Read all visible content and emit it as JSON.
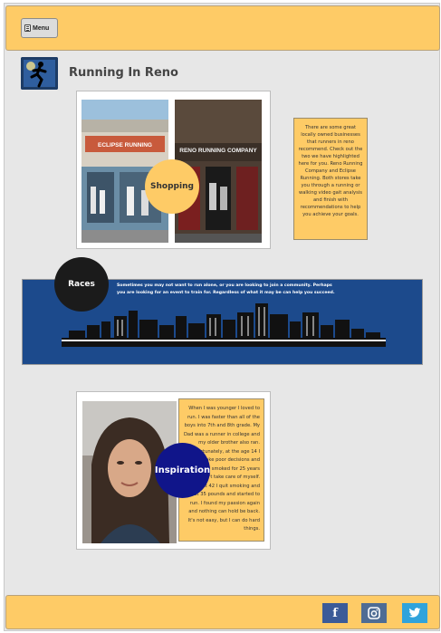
{
  "header": {
    "menu_label": "Menu"
  },
  "site": {
    "title": "Running In Reno"
  },
  "shopping": {
    "circle_label": "Shopping",
    "store1_sign": "ECLIPSE RUNNING",
    "store2_sign": "RENO RUNNING COMPANY",
    "text": "There are some great locally owned businesses that runners in reno recommend. Check out the two we have highlighted here for you. Reno Running Company and Eclipse Running. Both stores take you through a running or walking video gait analysis and finish with recommendations to help you achieve your goals."
  },
  "races": {
    "circle_label": "Races",
    "text": "Sometimes you may not want to run alone, or you are looking to join a community. Perhaps you are looking for an event to train for. Regardless of what it may be can help you succeed."
  },
  "inspiration": {
    "circle_label": "Inspiration",
    "text": "When I was younger I loved to run. I was faster than all of the boys into 7th and 8th grade. My Dad was a runner in college and my older brother also ran. Unfortunately, at the age 14 I did make poor decisions and smoking. I smoked for 25 years and didn't take care of myself. Now at 42 I quit smoking and lost 35 pounds and started to run. I found my passion again and nothing can hold be back. It's not easy, but I can do hard things."
  },
  "footer": {
    "facebook_icon": "f",
    "instagram_icon": "instagram-icon",
    "twitter_icon": "twitter-icon"
  },
  "colors": {
    "accent": "#fecb66",
    "banner_blue": "#1c4a8c",
    "inspiration_circle": "#10158a",
    "races_circle": "#1b1b1b"
  }
}
